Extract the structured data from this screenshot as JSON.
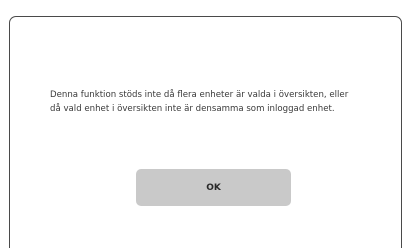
{
  "dialog": {
    "message": "Denna funktion stöds inte då flera enheter är valda i översikten, eller då vald enhet i översikten inte är densamma som inloggad enhet.",
    "ok_label": "OK"
  }
}
